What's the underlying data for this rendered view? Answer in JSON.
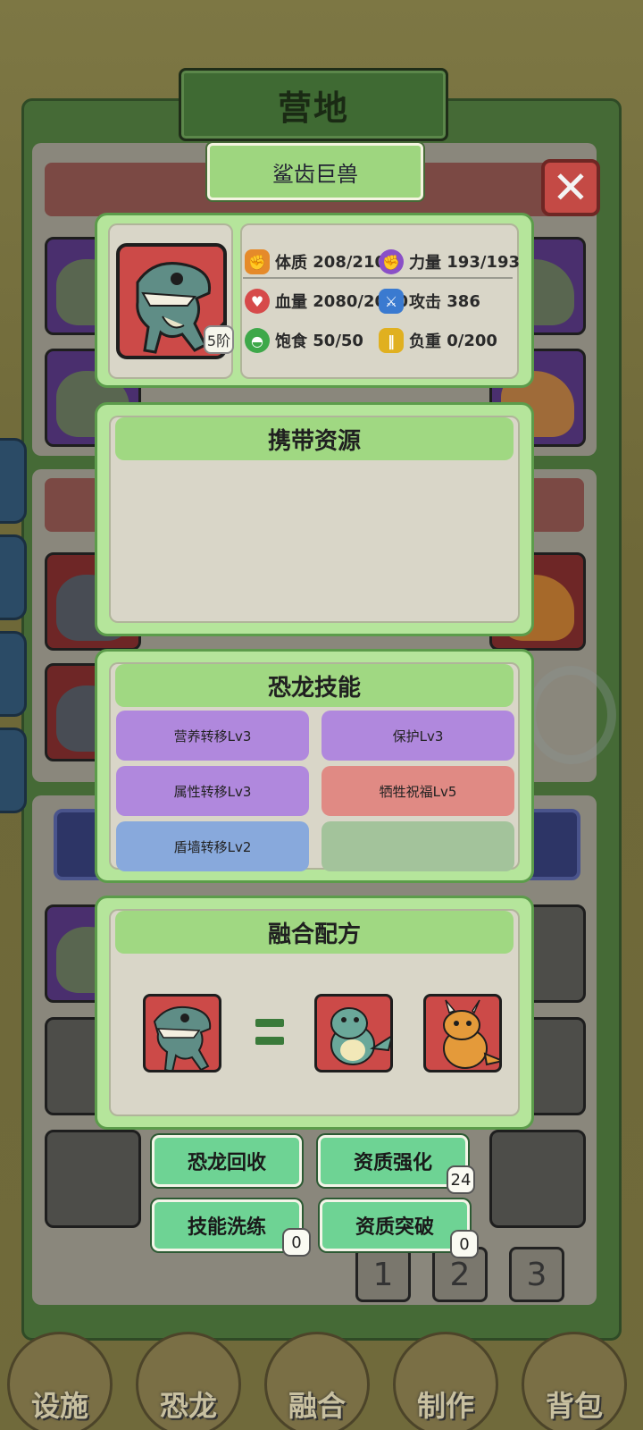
{
  "window_title": "营地",
  "dino_name": "鲨齿巨兽",
  "close_symbol": "✕",
  "tier_badge": "5阶",
  "stats": {
    "constitution": {
      "label": "体质",
      "value": "208/210",
      "icon": "flexed-arm-icon"
    },
    "strength": {
      "label": "力量",
      "value": "193/193",
      "icon": "fist-icon"
    },
    "hp": {
      "label": "血量",
      "value": "2080/2080",
      "icon": "heart-icon"
    },
    "attack": {
      "label": "攻击",
      "value": "386",
      "icon": "sword-icon"
    },
    "satiety": {
      "label": "饱食",
      "value": "50/50",
      "icon": "food-bowl-icon"
    },
    "load": {
      "label": "负重",
      "value": "0/200",
      "icon": "dumbbell-icon"
    }
  },
  "resources": {
    "title": "携带资源",
    "items": []
  },
  "skills": {
    "title": "恐龙技能",
    "items": [
      {
        "label": "营养转移Lv3",
        "color": "purple"
      },
      {
        "label": "保护Lv3",
        "color": "purple"
      },
      {
        "label": "属性转移Lv3",
        "color": "purple"
      },
      {
        "label": "牺牲祝福Lv5",
        "color": "red"
      },
      {
        "label": "盾墙转移Lv2",
        "color": "blue"
      },
      {
        "label": "",
        "color": "empty"
      }
    ]
  },
  "recipe": {
    "title": "融合配方"
  },
  "actions": {
    "recycle": "恐龙回收",
    "enhance": "资质强化",
    "enhance_count": "24",
    "reroll": "技能洗练",
    "reroll_count": "0",
    "breakthrough": "资质突破",
    "breakthrough_count": "0"
  },
  "pages": [
    "1",
    "2",
    "3"
  ],
  "bottom_nav": [
    "设施",
    "恐龙",
    "融合",
    "制作",
    "背包"
  ],
  "colors": {
    "panel_green": "#b5e59b",
    "header_green": "#a0d882",
    "button_green": "#6ed394",
    "slot_red": "#cc4a48",
    "skill_purple": "#b088dd",
    "skill_red": "#e08a84",
    "skill_blue": "#88a9dc"
  }
}
